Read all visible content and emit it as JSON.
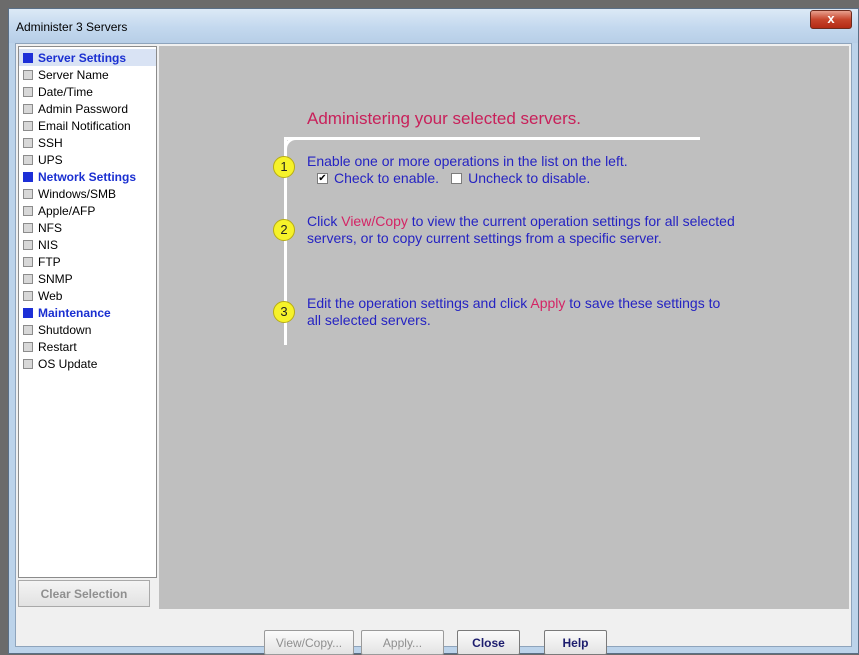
{
  "window": {
    "title": "Administer 3 Servers",
    "close_label": "x"
  },
  "sidebar": {
    "items": [
      {
        "label": "Server Settings",
        "type": "header"
      },
      {
        "label": "Server Name",
        "type": "item"
      },
      {
        "label": "Date/Time",
        "type": "item"
      },
      {
        "label": "Admin Password",
        "type": "item"
      },
      {
        "label": "Email Notification",
        "type": "item"
      },
      {
        "label": "SSH",
        "type": "item"
      },
      {
        "label": "UPS",
        "type": "item"
      },
      {
        "label": "Network Settings",
        "type": "header"
      },
      {
        "label": "Windows/SMB",
        "type": "item"
      },
      {
        "label": "Apple/AFP",
        "type": "item"
      },
      {
        "label": "NFS",
        "type": "item"
      },
      {
        "label": "NIS",
        "type": "item"
      },
      {
        "label": "FTP",
        "type": "item"
      },
      {
        "label": "SNMP",
        "type": "item"
      },
      {
        "label": "Web",
        "type": "item"
      },
      {
        "label": "Maintenance",
        "type": "header"
      },
      {
        "label": "Shutdown",
        "type": "item"
      },
      {
        "label": "Restart",
        "type": "item"
      },
      {
        "label": "OS Update",
        "type": "item"
      }
    ],
    "clear_label": "Clear Selection"
  },
  "intro": {
    "heading": "Administering your selected servers.",
    "steps": [
      {
        "num": "1",
        "text": "Enable one or more operations in the list on the left."
      },
      {
        "num": "2",
        "pre": "Click ",
        "highlight": "View/Copy",
        "post": " to view the current operation settings for all selected servers, or to copy current settings from a specific server."
      },
      {
        "num": "3",
        "pre": "Edit the operation settings and click ",
        "highlight": "Apply",
        "post": " to save these settings to all selected servers."
      }
    ],
    "legend": {
      "checked_label": "Check to enable.",
      "unchecked_label": "Uncheck to disable.",
      "check_mark": "✔"
    }
  },
  "buttons": {
    "view_copy": "View/Copy...",
    "apply": "Apply...",
    "close": "Close",
    "help": "Help"
  },
  "colors": {
    "header_text": "#1a2fd1",
    "heading": "#c8205a",
    "step_text": "#2523c2",
    "step_badge": "#f6f22a",
    "content_bg": "#bfbfbf"
  }
}
